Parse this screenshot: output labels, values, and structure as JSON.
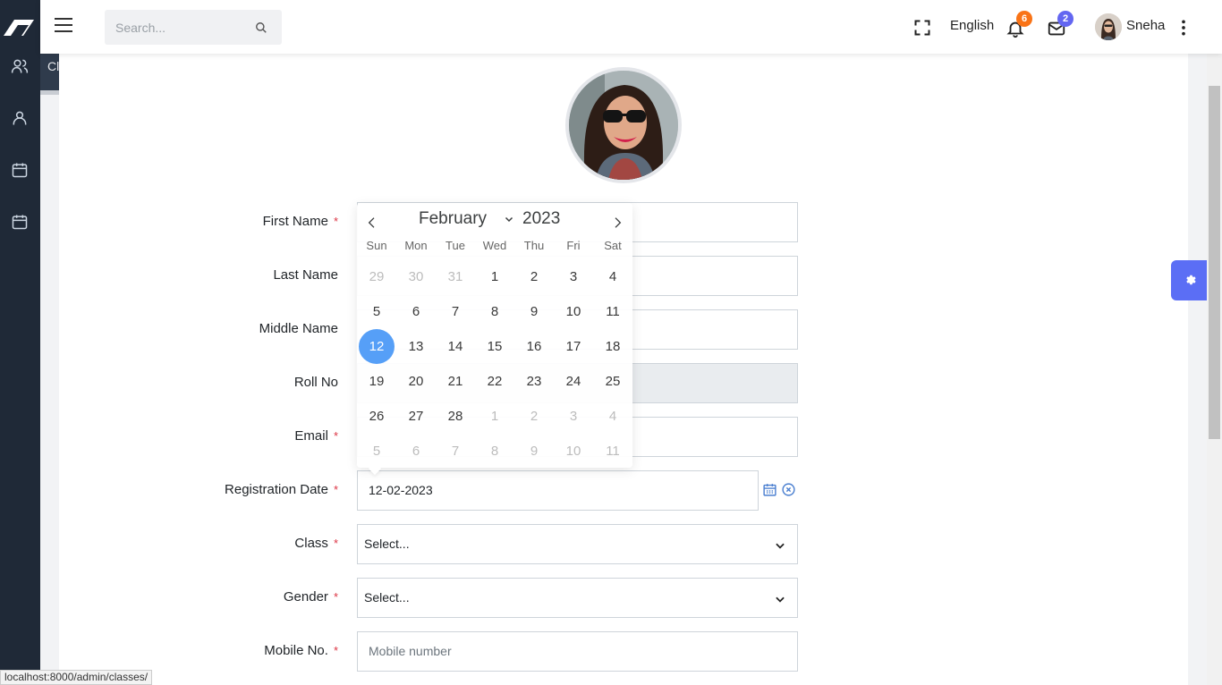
{
  "sidebar": {
    "flyout_label": "Classes",
    "icons": [
      "users-icon",
      "user-icon",
      "calendar-icon",
      "calendar-icon"
    ]
  },
  "header": {
    "search_placeholder": "Search...",
    "language": "English",
    "notifications_count": "6",
    "messages_count": "2",
    "user_name": "Sneha",
    "notif_badge_color": "#f97316",
    "msg_badge_color": "#6366f1"
  },
  "form": {
    "first_name_label": "First Name",
    "last_name_label": "Last Name",
    "middle_name_label": "Middle Name",
    "roll_no_label": "Roll No",
    "email_label": "Email",
    "registration_date_label": "Registration Date",
    "registration_date_value": "12-02-2023",
    "class_label": "Class",
    "class_value": "Select...",
    "gender_label": "Gender",
    "gender_value": "Select...",
    "mobile_label": "Mobile No.",
    "mobile_placeholder": "Mobile number",
    "required_mark": "*"
  },
  "calendar": {
    "month": "February",
    "year": "2023",
    "weekdays": [
      "Sun",
      "Mon",
      "Tue",
      "Wed",
      "Thu",
      "Fri",
      "Sat"
    ],
    "weeks": [
      [
        "29",
        "30",
        "31",
        "1",
        "2",
        "3",
        "4"
      ],
      [
        "5",
        "6",
        "7",
        "8",
        "9",
        "10",
        "11"
      ],
      [
        "12",
        "13",
        "14",
        "15",
        "16",
        "17",
        "18"
      ],
      [
        "19",
        "20",
        "21",
        "22",
        "23",
        "24",
        "25"
      ],
      [
        "26",
        "27",
        "28",
        "1",
        "2",
        "3",
        "4"
      ],
      [
        "5",
        "6",
        "7",
        "8",
        "9",
        "10",
        "11"
      ]
    ],
    "selected_day": "12",
    "selected_color": "#569ff7"
  },
  "statusbar": {
    "url": "localhost:8000/admin/classes/"
  }
}
